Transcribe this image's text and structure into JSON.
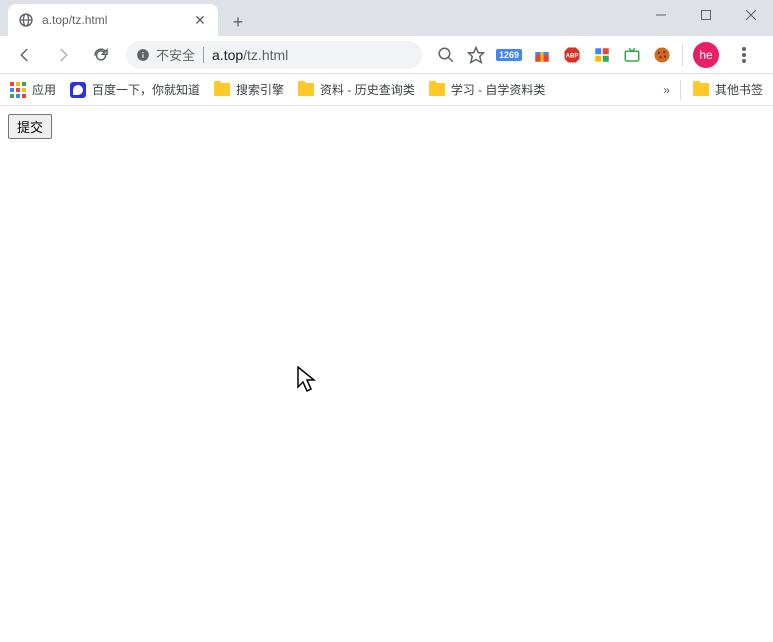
{
  "tab": {
    "title": "a.top/tz.html"
  },
  "address": {
    "insecure_label": "不安全",
    "host": "a.top",
    "path": "/tz.html"
  },
  "extensions": {
    "badge": "1269"
  },
  "profile": {
    "initials": "he"
  },
  "bookmarks": {
    "apps": "应用",
    "items": [
      {
        "label": "百度一下，你就知道"
      },
      {
        "label": "搜索引擎"
      },
      {
        "label": "资料 - 历史查询类"
      },
      {
        "label": "学习 - 自学资料类"
      }
    ],
    "other": "其他书签"
  },
  "page": {
    "submit_label": "提交"
  }
}
